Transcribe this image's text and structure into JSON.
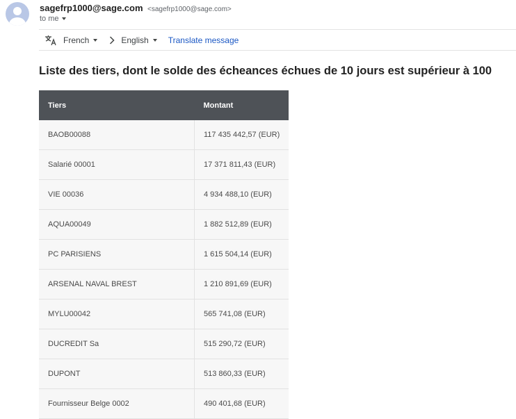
{
  "header": {
    "sender_name": "sagefrp1000@sage.com",
    "sender_email": "<sagefrp1000@sage.com>",
    "recipient_label": "to me"
  },
  "translate": {
    "from_language": "French",
    "to_language": "English",
    "link_label": "Translate message"
  },
  "message": {
    "heading": "Liste des tiers, dont le solde des écheances échues de 10 jours est supérieur à 100",
    "table": {
      "columns": [
        "Tiers",
        "Montant"
      ],
      "rows": [
        [
          "BAOB00088",
          "117 435 442,57 (EUR)"
        ],
        [
          "Salarié 00001",
          "17 371 811,43 (EUR)"
        ],
        [
          "VIE 00036",
          "4 934 488,10 (EUR)"
        ],
        [
          "AQUA00049",
          "1 882 512,89 (EUR)"
        ],
        [
          "PC PARISIENS",
          "1 615 504,14 (EUR)"
        ],
        [
          "ARSENAL NAVAL BREST",
          "1 210 891,69 (EUR)"
        ],
        [
          "MYLU00042",
          "565 741,08 (EUR)"
        ],
        [
          "DUCREDIT Sa",
          "515 290,72 (EUR)"
        ],
        [
          "DUPONT",
          "513 860,33 (EUR)"
        ],
        [
          "Fournisseur Belge 0002",
          "490 401,68 (EUR)"
        ]
      ]
    }
  },
  "colors": {
    "table_header_bg": "#4e5257",
    "row_bg": "#f7f7f7",
    "link": "#1a57c4",
    "avatar_bg": "#b9c7e6"
  },
  "icons": {
    "avatar": "default-avatar-icon",
    "translate": "translate-icon",
    "dropdown": "caret-down-icon",
    "arrow": "chevron-right-icon"
  }
}
